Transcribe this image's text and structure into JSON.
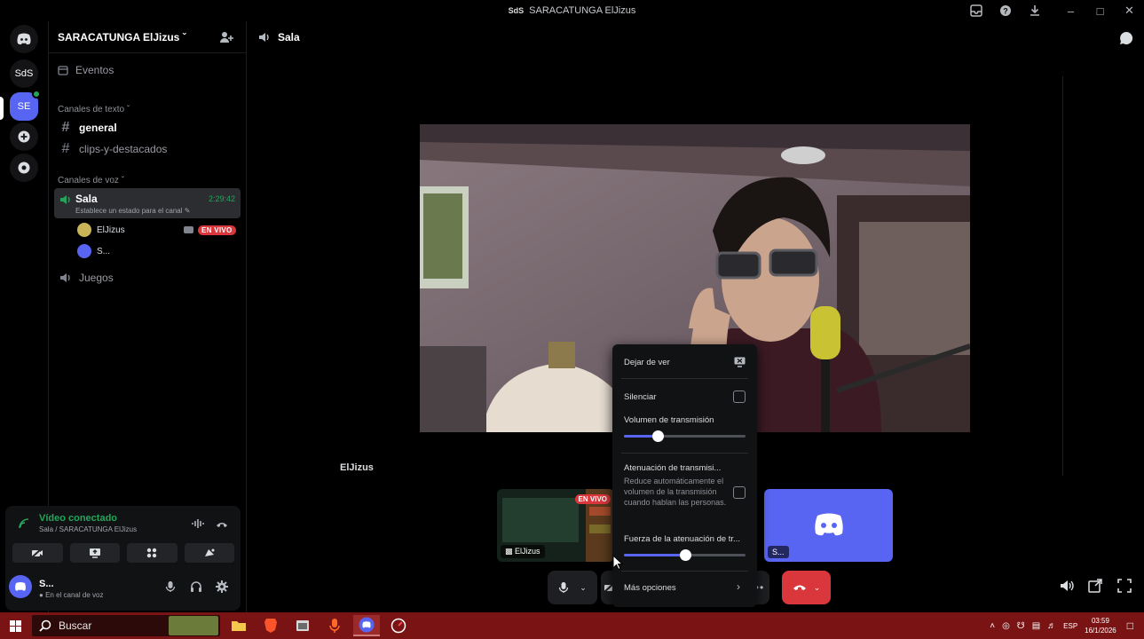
{
  "window": {
    "title": "SARACATUNGA ElJizus",
    "title_icon": "SdS"
  },
  "servers": [
    {
      "label": "SdS",
      "active": false
    },
    {
      "label": "SE",
      "active": true
    }
  ],
  "guild": {
    "name": "SARACATUNGA ElJizus"
  },
  "sidebar": {
    "events_label": "Eventos",
    "text_category": "Canales de texto",
    "text_channels": [
      "general",
      "clips-y-destacados"
    ],
    "voice_category": "Canales de voz",
    "voice_channels": [
      {
        "name": "Sala",
        "status": "Establece un estado para el canal",
        "time": "2:29:42"
      },
      {
        "name": "Juegos"
      }
    ],
    "voice_users": [
      {
        "name": "ElJizus",
        "live": "EN VIVO"
      },
      {
        "name": "S..."
      }
    ]
  },
  "rtc": {
    "title": "Vídeo conectado",
    "subtitle": "Sala / SARACATUNGA ElJizus"
  },
  "user": {
    "name": "S...",
    "status": "En el canal de voz"
  },
  "main": {
    "channel_title": "Sala",
    "streamer_name": "ElJizus",
    "thumb1_label": "ElJizus",
    "thumb1_live": "EN VIVO",
    "thumb2_label": "S..."
  },
  "context_menu": {
    "stop_watching": "Dejar de ver",
    "mute": "Silenciar",
    "stream_volume": "Volumen de transmisión",
    "stream_volume_value": 0.28,
    "attenuation_title": "Atenuación de transmisi...",
    "attenuation_desc": "Reduce automáticamente el volumen de la transmisión cuando hablan las personas.",
    "attenuation_strength": "Fuerza de la atenuación de tr...",
    "attenuation_strength_value": 0.5,
    "more_options": "Más opciones"
  },
  "taskbar": {
    "search_placeholder": "Buscar",
    "language": "ESP",
    "time": "03:59",
    "date": "16/1/2026"
  },
  "colors": {
    "accent": "#5865f2",
    "green": "#23a55a",
    "red": "#da373c",
    "taskbar": "#7a1414"
  }
}
